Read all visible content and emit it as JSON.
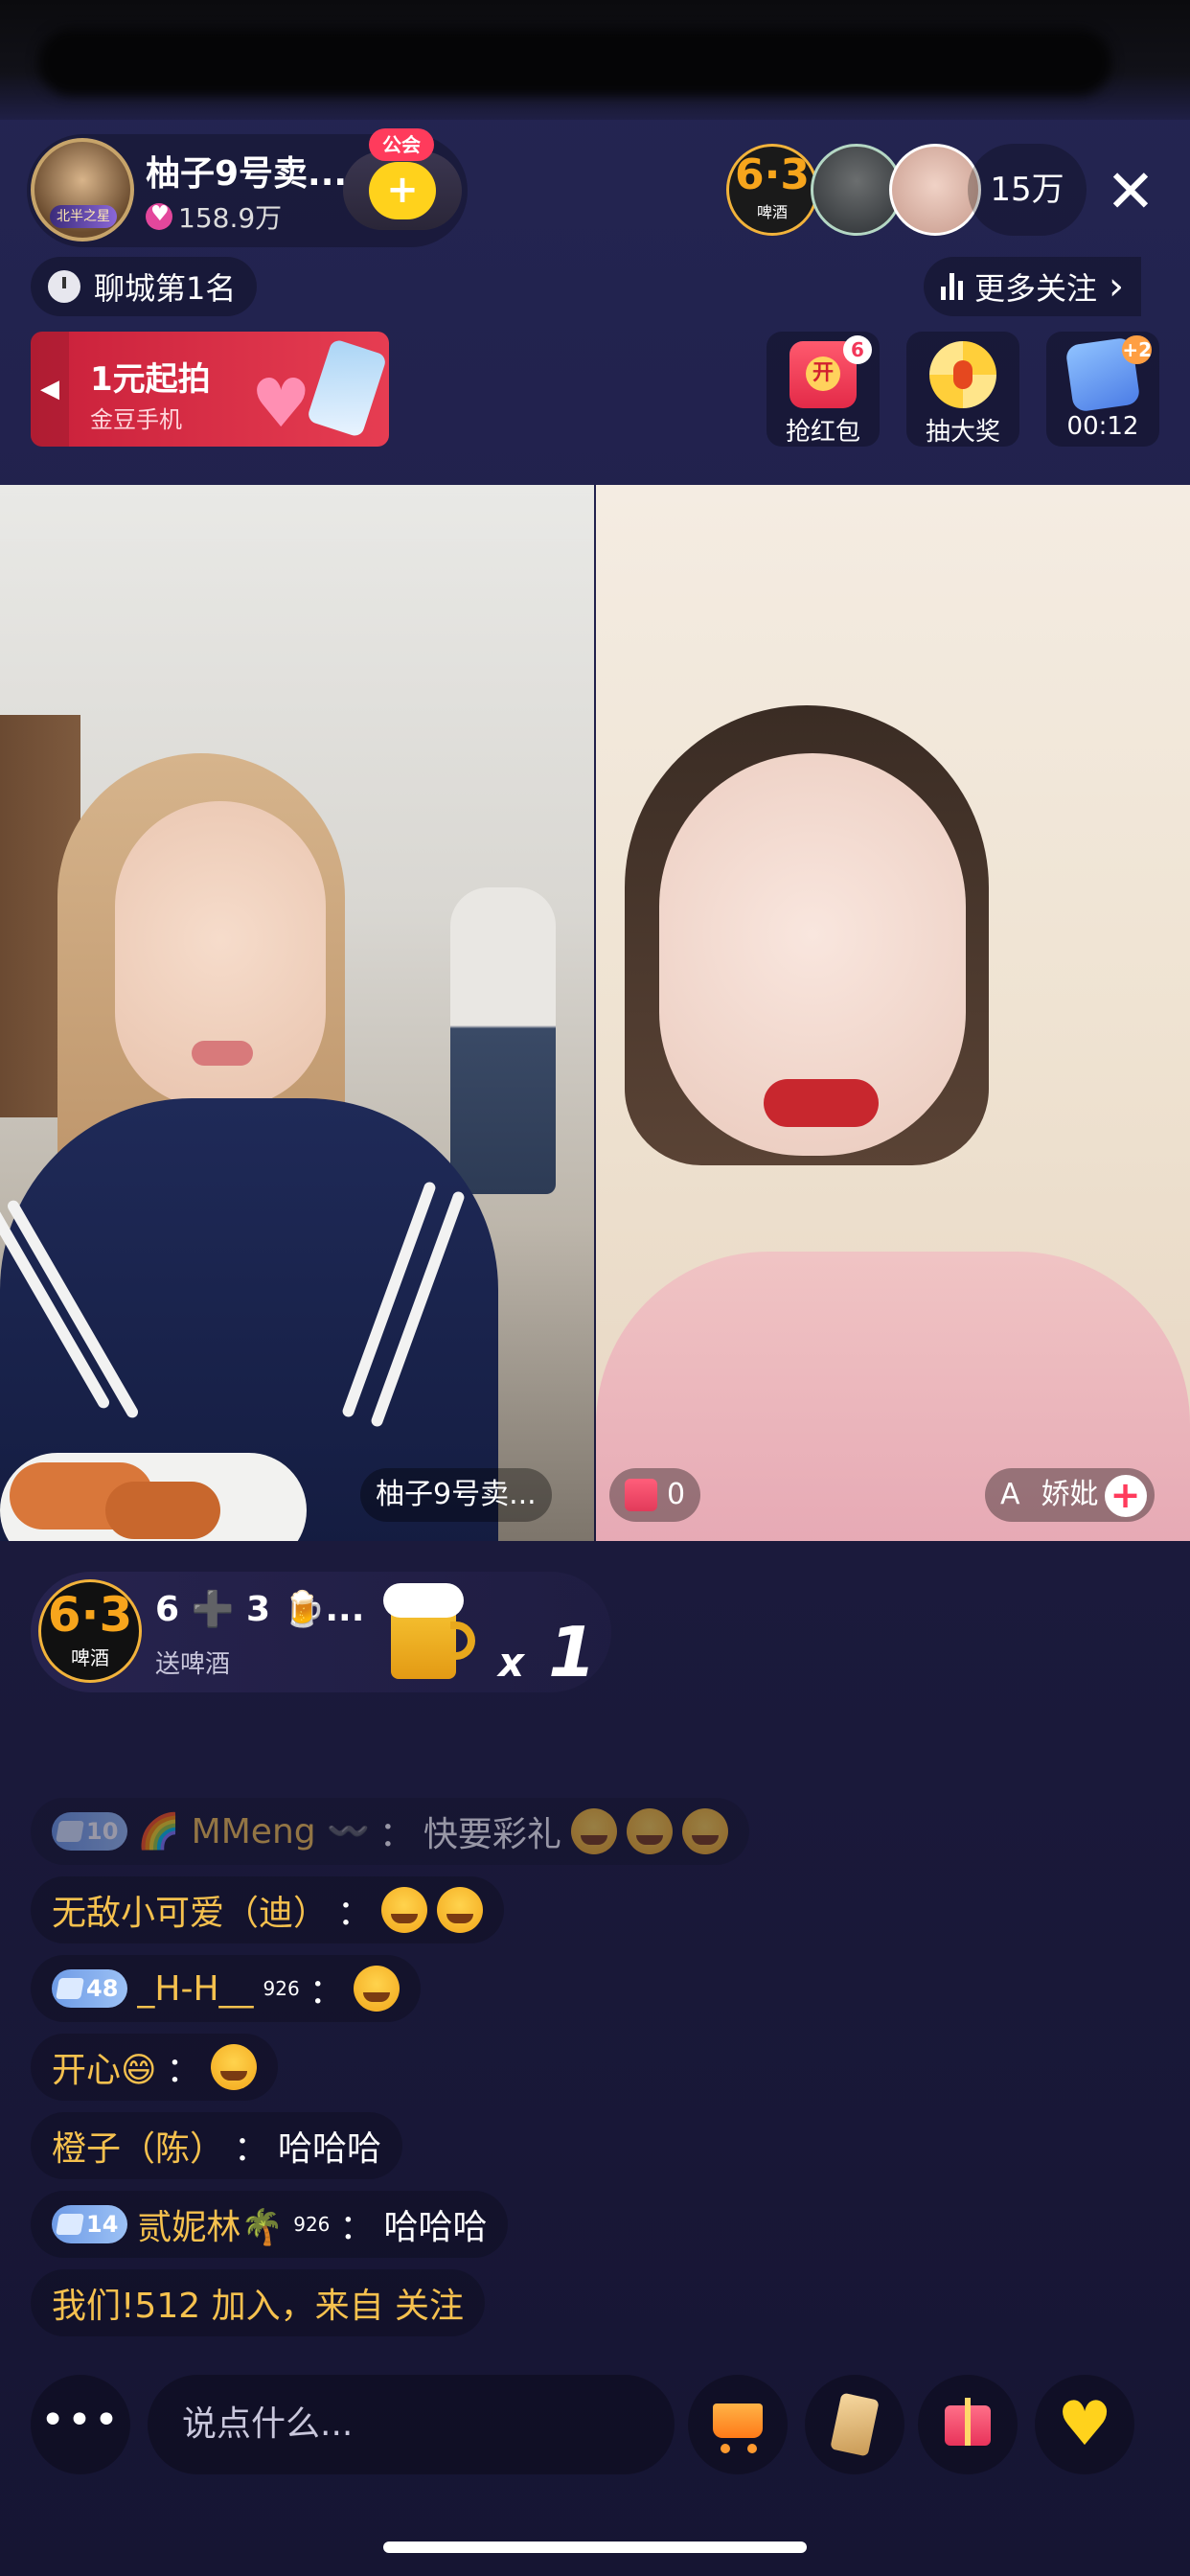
{
  "host": {
    "name": "柚子9号卖...",
    "likes": "158.9万",
    "avatar_badge": "北半之星",
    "follow_tag": "公会",
    "follow_icon": "+"
  },
  "top_right": {
    "sponsor_big": "6·3",
    "sponsor_small": "啤酒",
    "viewer_count": "15万",
    "close": "✕"
  },
  "rank": {
    "label": "聊城第1名"
  },
  "more_follow": {
    "label": "更多关注",
    "chevron": "›"
  },
  "promo": {
    "title": "1元起拍",
    "subtitle": "金豆手机"
  },
  "tools": [
    {
      "label": "抢红包",
      "badge": "6"
    },
    {
      "label": "抽大奖",
      "badge": ""
    },
    {
      "label": "00:12",
      "badge": "+2"
    }
  ],
  "video": {
    "left_name": "柚子9号卖...",
    "right_gift_count": "0",
    "right_name": "娇妣",
    "right_prefix": "A"
  },
  "gift_banner": {
    "logo_big": "6·3",
    "logo_small": "啤酒",
    "title": "6 ➕ 3 🍺...",
    "subtitle": "送啤酒",
    "combo_x": "x",
    "combo_n": "1"
  },
  "chat": [
    {
      "level": "10",
      "user": "🌈 MMeng 〰️",
      "sep": "：",
      "text": "快要彩礼",
      "emojis": 3,
      "faded": true
    },
    {
      "level": "",
      "user": "无敌小可爱（迪）",
      "sep": "：",
      "text": "",
      "emojis": 2,
      "faded": false
    },
    {
      "level": "48",
      "user": "_H-H__",
      "sup": "926",
      "sep": "：",
      "text": "",
      "emojis": 1,
      "faded": false
    },
    {
      "level": "",
      "user": "开心😄",
      "sep": "：",
      "text": "",
      "emojis": 1,
      "faded": false
    },
    {
      "level": "",
      "user": "橙子（陈）",
      "sep": "：",
      "text": "哈哈哈",
      "emojis": 0,
      "faded": false
    },
    {
      "level": "14",
      "user": "贰妮林🌴",
      "sup": "926",
      "sep": "：",
      "text": "哈哈哈",
      "emojis": 0,
      "faded": false
    },
    {
      "level": "",
      "user": "",
      "sep": "",
      "text": "我们!512 加入，来自 关注",
      "emojis": 0,
      "faded": false
    }
  ],
  "bottom": {
    "more": "•••",
    "input_placeholder": "说点什么..."
  }
}
